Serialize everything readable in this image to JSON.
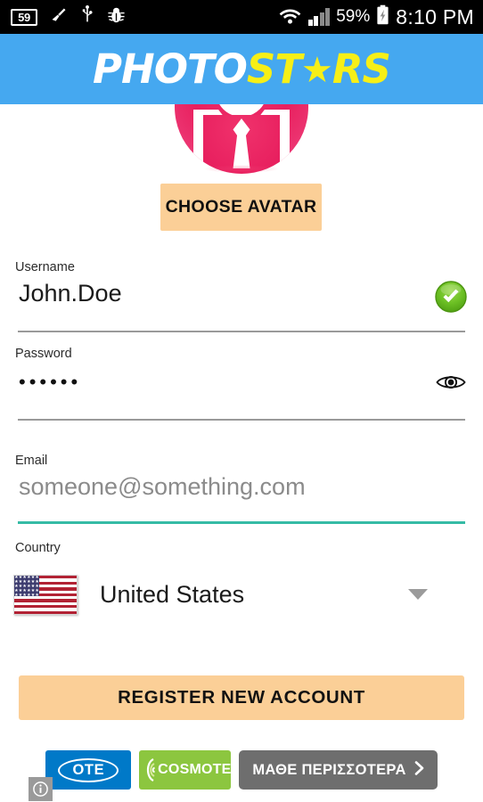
{
  "status_bar": {
    "notification_count": "59",
    "icons_left": [
      "notification-count-badge",
      "cleaner-broom-icon",
      "usb-icon",
      "bug-icon"
    ],
    "icons_right": [
      "wifi-icon",
      "signal-bars-icon",
      "battery-charging-icon"
    ],
    "battery_percent": "59%",
    "time": "8:10 PM"
  },
  "header": {
    "logo_part1": "PHOTO",
    "logo_part2": "ST",
    "logo_star": "★",
    "logo_part3": "RS",
    "background_color": "#45a8f0",
    "logo_white": "#ffffff",
    "logo_yellow": "#f6ef17"
  },
  "avatar": {
    "name": "default-avatar-person-with-tie",
    "color": "#e8205f",
    "choose_button_label": "CHOOSE AVATAR"
  },
  "form": {
    "username": {
      "label": "Username",
      "value": "John.Doe",
      "valid": true,
      "status_icon": "green-check-circle-icon"
    },
    "password": {
      "label": "Password",
      "masked_value": "••••••",
      "length": 6,
      "toggle_icon": "eye-icon"
    },
    "email": {
      "label": "Email",
      "value": "",
      "placeholder": "someone@something.com",
      "underline_color": "#36bba5",
      "focused": true
    },
    "country": {
      "label": "Country",
      "value": "United States",
      "flag": "us-flag-icon",
      "caret_icon": "chevron-down-icon"
    }
  },
  "actions": {
    "register_label": "REGISTER NEW ACCOUNT",
    "button_color": "#fbcf97"
  },
  "ad": {
    "brand1": "OTE",
    "brand2": "COSMOTE",
    "cta_label": "ΜΑΘΕ ΠΕΡΙΣΣΟΤΕΡΑ",
    "cta_arrow": "›",
    "info_label": "ⓘ",
    "brand1_color": "#0079c8",
    "brand2_color": "#8cc63f",
    "cta_color": "#6e6e6e"
  }
}
